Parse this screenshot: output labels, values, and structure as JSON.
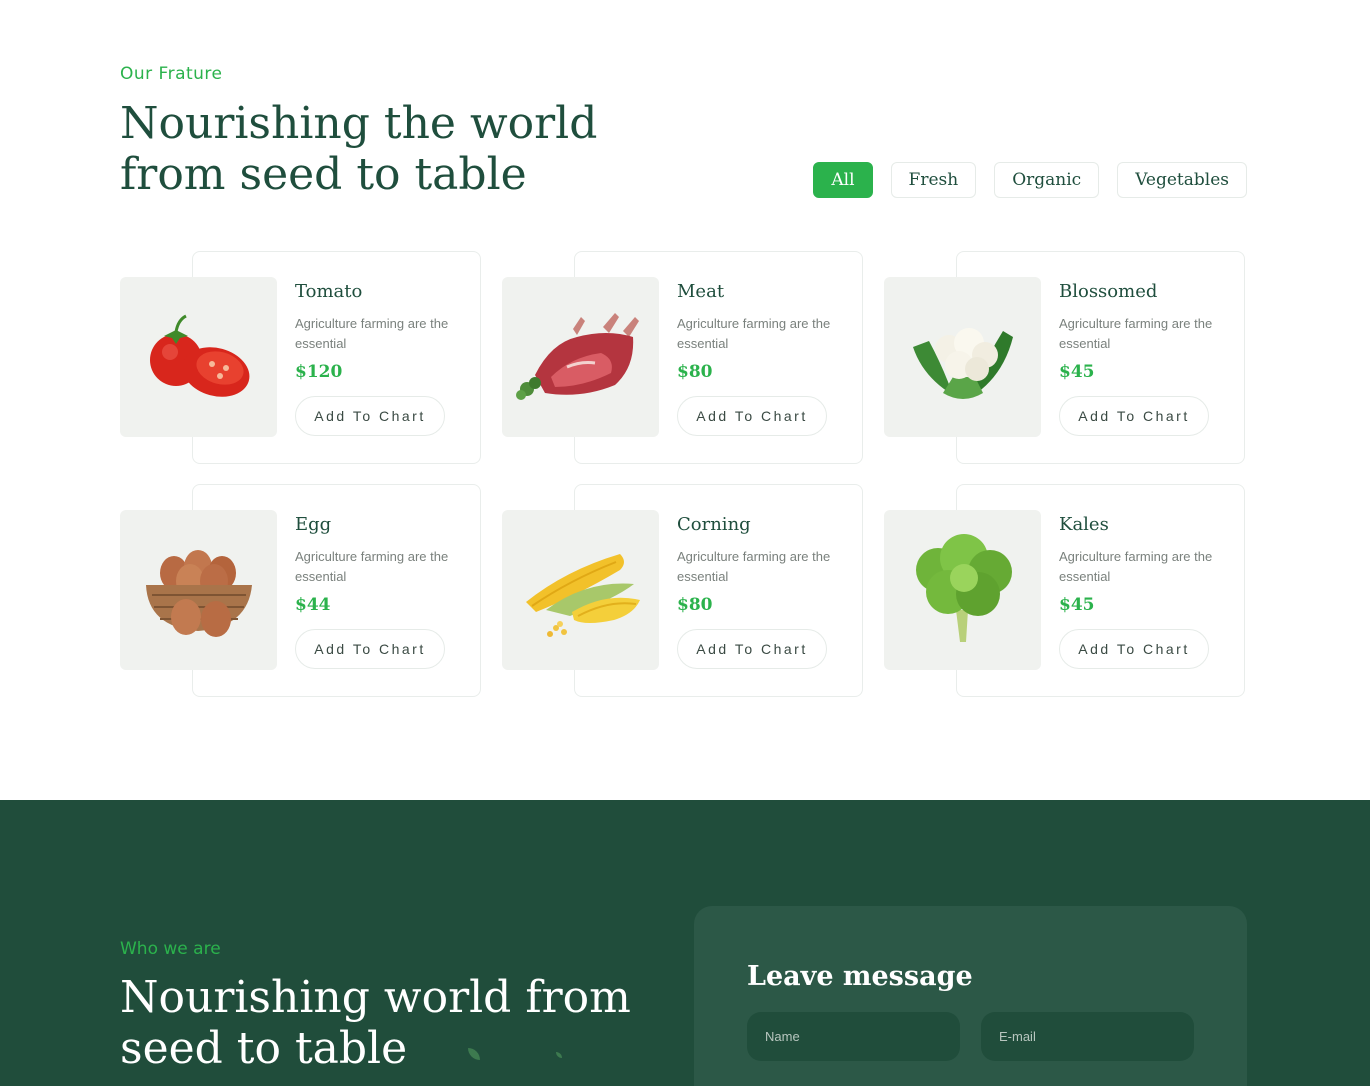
{
  "features": {
    "eyebrow": "Our Frature",
    "headline_line1": "Nourishing the world",
    "headline_line2": "from seed to table",
    "filters": [
      {
        "label": "All",
        "active": true
      },
      {
        "label": "Fresh",
        "active": false
      },
      {
        "label": "Organic",
        "active": false
      },
      {
        "label": "Vegetables",
        "active": false
      }
    ],
    "products": [
      {
        "name": "Tomato",
        "desc": "Agriculture farming are the essential",
        "price": "$120",
        "button": "Add To Chart",
        "image": "tomato-image"
      },
      {
        "name": "Meat",
        "desc": "Agriculture farming are the essential",
        "price": "$80",
        "button": "Add To Chart",
        "image": "meat-image"
      },
      {
        "name": "Blossomed",
        "desc": "Agriculture farming are the essential",
        "price": "$45",
        "button": "Add To Chart",
        "image": "cauliflower-image"
      },
      {
        "name": "Egg",
        "desc": "Agriculture farming are the essential",
        "price": "$44",
        "button": "Add To Chart",
        "image": "egg-basket-image"
      },
      {
        "name": "Corning",
        "desc": "Agriculture farming are the essential",
        "price": "$80",
        "button": "Add To Chart",
        "image": "corn-image"
      },
      {
        "name": "Kales",
        "desc": "Agriculture farming are the essential",
        "price": "$45",
        "button": "Add To Chart",
        "image": "kale-image"
      }
    ]
  },
  "about": {
    "eyebrow": "Who we are",
    "headline_line1": "Nourishing world from",
    "headline_line2": "seed to table"
  },
  "message_form": {
    "title": "Leave message",
    "name_placeholder": "Name",
    "email_placeholder": "E-mail"
  },
  "colors": {
    "accent": "#2bb24c",
    "heading": "#1f4e3d",
    "dark_section": "#204d3b",
    "form_card": "#2c5847"
  }
}
